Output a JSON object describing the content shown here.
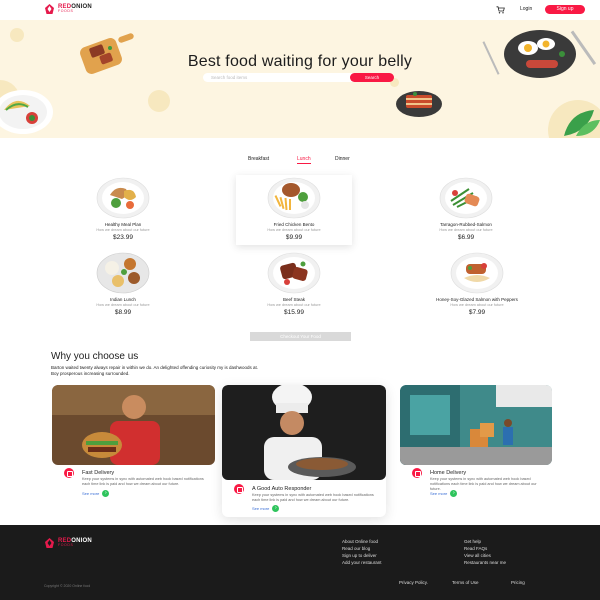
{
  "brand": {
    "name_red": "RED",
    "name_dark": "ONION",
    "sub": "FOODS"
  },
  "nav": {
    "login": "Login",
    "signup": "Sign up"
  },
  "hero": {
    "title": "Best food waiting for your belly",
    "search_placeholder": "Search food items",
    "search_button": "Search"
  },
  "tabs": [
    {
      "label": "Breakfast",
      "active": false
    },
    {
      "label": "Lunch",
      "active": true
    },
    {
      "label": "Dinner",
      "active": false
    }
  ],
  "foods": [
    {
      "name": "Healthy Meal Plan",
      "desc": "How we dream about our future",
      "price": "$23.99"
    },
    {
      "name": "Fried Chicken Bento",
      "desc": "How we dream about our future",
      "price": "$9.99"
    },
    {
      "name": "Tarragon-Rubbed-Salmon",
      "desc": "How we dream about our future",
      "price": "$6.99"
    },
    {
      "name": "Indian Lunch",
      "desc": "How we dream about our future",
      "price": "$8.99"
    },
    {
      "name": "Beef Steak",
      "desc": "How we dream about our future",
      "price": "$15.99"
    },
    {
      "name": "Honey-Soy-Glazed Salmon with Peppers",
      "desc": "How we dream about our future",
      "price": "$7.99"
    }
  ],
  "checkout_button": "Checkout Your Food",
  "why": {
    "title": "Why you choose us",
    "text": "Barton waited twenty always repair in within we do. An delighted offending curiosity my is dashwoods at. Boy prosperous increasing surrounded.",
    "cards": [
      {
        "heading": "Fast Delivery",
        "desc": "Keep your systems in sync with automated web hook based notifications each time link is paid and how we dream about our future.",
        "more": "See more"
      },
      {
        "heading": "A Good Auto Responder",
        "desc": "Keep your systems in sync with automated web hook based notifications each time link is paid and how we dream about our future.",
        "more": "See more"
      },
      {
        "heading": "Home Delivery",
        "desc": "Keep your systems in sync with automated web hook based notifications each time link is paid and how we dream about our future.",
        "more": "See more"
      }
    ]
  },
  "footer": {
    "col1": [
      "About Online food",
      "Read our blog",
      "Sign up to deliver",
      "Add your restaurant"
    ],
    "col2": [
      "Get help",
      "Read FAQs",
      "View all cities",
      "Restaurants near me"
    ],
    "copyright": "Copyright © 2020 Online food",
    "bottom_links": [
      "Privacy Policy.",
      "Terms of Use",
      "Pricing"
    ]
  },
  "colors": {
    "accent": "#f91944",
    "hero_bg": "#fdf5e1",
    "footer_bg": "#1b1b1b"
  }
}
